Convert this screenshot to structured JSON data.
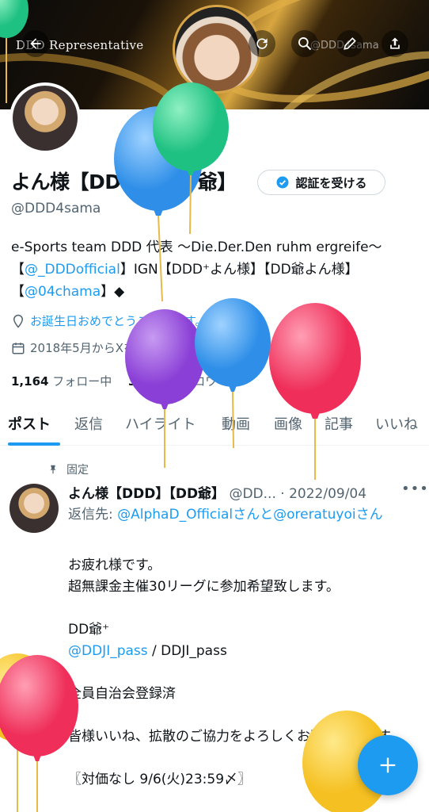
{
  "header": {
    "banner_name": "DDD Representative",
    "banner_handle": "@DDD4sama"
  },
  "profile": {
    "name": "よん様【DDD】【DD爺】",
    "verify_label": "認証を受ける",
    "handle": "@DDD4sama",
    "bio_1": "e-Sports team DDD 代表 〜Die.Der.Den ruhm ergreife〜【",
    "bio_link_1": "@_DDDofficial",
    "bio_2": "】IGN【DDD⁺よん様】【DD爺よん様】【",
    "bio_link_2": "@04chama",
    "bio_3": "】◆",
    "birthday": "お誕生日おめでとうございます。",
    "joined": "2018年5月からXを利用しています",
    "following_count": "1,164",
    "following_label": "フォロー中",
    "followers_count": "3,861",
    "followers_label": "フォロワー"
  },
  "tabs": [
    "ポスト",
    "返信",
    "ハイライト",
    "動画",
    "画像",
    "記事",
    "いいね"
  ],
  "post": {
    "pinned_label": "固定",
    "author": "よん様【DDD】【DD爺】",
    "handle_date": "@DD... · 2022/09/04",
    "reply_prefix": "返信先: ",
    "reply_user_1": "@AlphaD_Official",
    "reply_mid": "さんと",
    "reply_user_2": "@oreratuyoi",
    "reply_suffix": "さん",
    "body_1": "お疲れ様です。\n超無課金主催30リーグに参加希望致します。\n\nDD爺⁺\n",
    "body_link": "@DDJI_pass",
    "body_2": " / DDJI_pass\n\n全員自治会登録済\n\n皆様いいね、拡散のご協力をよろしくお願い致します。\n\n〖対価なし 9/6(火)23:59〆〗"
  },
  "colors": {
    "accent": "#1d9bf0",
    "text": "#0f1419",
    "muted": "#536471"
  },
  "icons": [
    "back-arrow-icon",
    "refresh-icon",
    "search-icon",
    "edit-icon",
    "share-icon",
    "verified-badge-icon",
    "location-pin-icon",
    "calendar-icon",
    "pin-icon",
    "more-icon",
    "plus-icon"
  ]
}
